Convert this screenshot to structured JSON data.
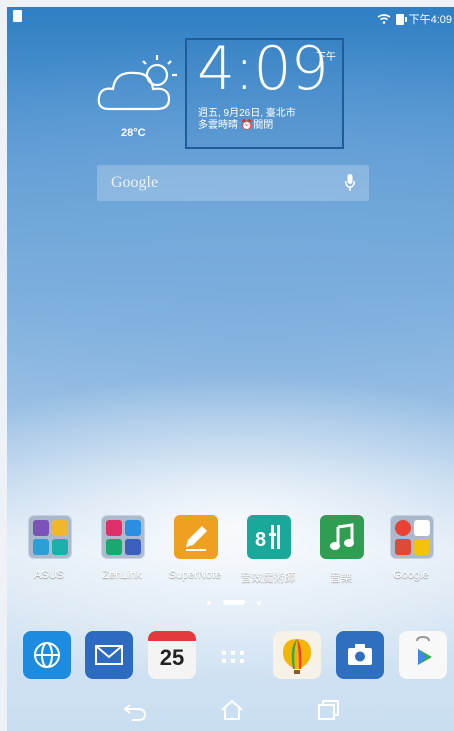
{
  "status_bar": {
    "time": "下午4:09"
  },
  "weather": {
    "temperature": "28°C",
    "icon": "partly-cloudy-icon"
  },
  "clock": {
    "time": "4:09",
    "ampm": "下午",
    "date_line": "週五, 9月26日, 臺北市",
    "weather_line": "多雲時晴  ⏰關閉"
  },
  "search": {
    "label": "Google"
  },
  "apps": [
    {
      "label": "ASUS"
    },
    {
      "label": "ZenLink"
    },
    {
      "label": "SuperNote"
    },
    {
      "label": "音效魔術師"
    },
    {
      "label": "音樂"
    },
    {
      "label": "Google"
    }
  ],
  "dock": {
    "calendar_day": "25"
  },
  "colors": {
    "accent": "#1f5d96",
    "supernote": "#f0a020",
    "audiowizard": "#1aa89a",
    "music": "#2f9d52",
    "browser": "#1c8be0",
    "mail": "#2d6ac2"
  }
}
